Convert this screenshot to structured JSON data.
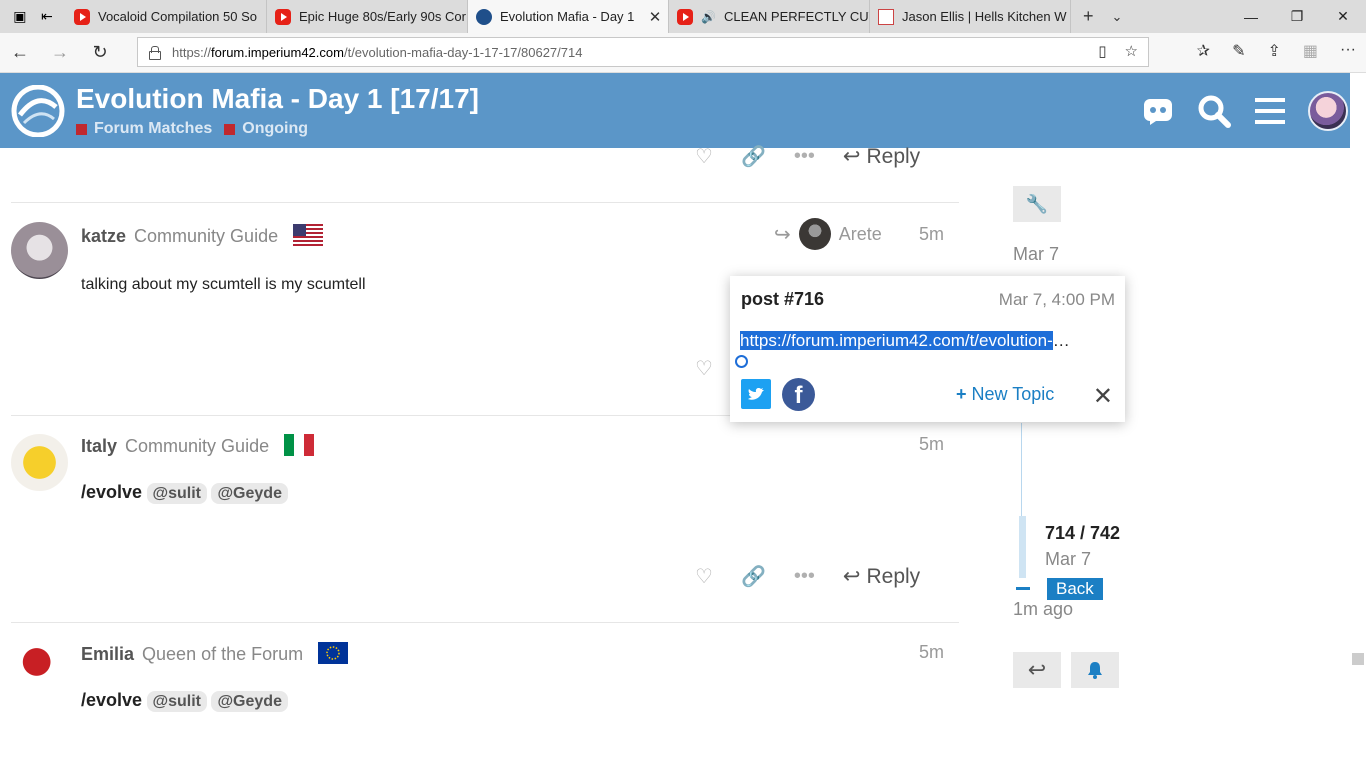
{
  "browser": {
    "tabs": [
      {
        "title": "Vocaloid Compilation 50 So",
        "icon": "youtube-icon"
      },
      {
        "title": "Epic Huge 80s/Early 90s Cor",
        "icon": "youtube-icon"
      },
      {
        "title": "Evolution Mafia - Day 1",
        "icon": "imperium-icon",
        "active": true
      },
      {
        "title": "CLEAN PERFECTLY CUT",
        "icon": "youtube-icon",
        "audio": true
      },
      {
        "title": "Jason Ellis | Hells Kitchen W",
        "icon": "hells-kitchen-icon"
      }
    ],
    "url_prefix": "https://",
    "url_host": "forum.imperium42.com",
    "url_path": "/t/evolution-mafia-day-1-17-17/80627/714"
  },
  "header": {
    "title": "Evolution Mafia - Day 1 [17/17]",
    "categories": [
      "Forum Matches",
      "Ongoing"
    ],
    "category_color": "#c0282e",
    "bar_color": "#5b96c8"
  },
  "top_actions": {
    "reply_label": "Reply"
  },
  "posts": [
    {
      "username": "katze",
      "user_title": "Community Guide",
      "flag": "us",
      "reply_to": "Arete",
      "time": "5m",
      "body": "talking about my scumtell is my scumtell"
    },
    {
      "username": "Italy",
      "user_title": "Community Guide",
      "flag": "it",
      "time": "5m",
      "command": "/evolve",
      "mentions": [
        "@sulit",
        "@Geyde"
      ],
      "reply_label": "Reply"
    },
    {
      "username": "Emilia",
      "user_title": "Queen of the Forum",
      "flag": "eu",
      "time": "5m",
      "command": "/evolve",
      "mentions": [
        "@sulit",
        "@Geyde"
      ]
    }
  ],
  "share_popup": {
    "title": "post #716",
    "date": "Mar 7, 4:00 PM",
    "link_selected": "https://forum.imperium42.com/t/evolution-",
    "link_rest": "…",
    "new_topic_label": "New Topic"
  },
  "timeline": {
    "start_date": "Mar 7",
    "position": "714 / 742",
    "current_date": "Mar 7",
    "back_label": "Back",
    "ago": "1m ago"
  }
}
